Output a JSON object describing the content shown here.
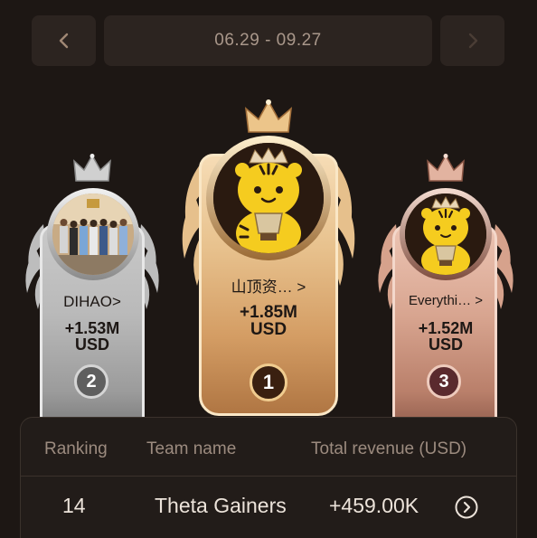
{
  "date_nav": {
    "range": "06.29 - 09.27",
    "prev_icon": "chevron-left-icon",
    "next_icon": "chevron-right-icon"
  },
  "podium": [
    {
      "rank": "2",
      "team": "DIHAO>",
      "revenue_value": "+1.53M",
      "revenue_unit": "USD",
      "tier": "silver"
    },
    {
      "rank": "1",
      "team": "山顶资… >",
      "revenue_value": "+1.85M",
      "revenue_unit": "USD",
      "tier": "gold"
    },
    {
      "rank": "3",
      "team": "Everythi… >",
      "revenue_value": "+1.52M",
      "revenue_unit": "USD",
      "tier": "bronze"
    }
  ],
  "table": {
    "headers": {
      "ranking": "Ranking",
      "team": "Team name",
      "revenue": "Total revenue (USD)"
    },
    "rows": [
      {
        "ranking": "14",
        "team": "Theta Gainers",
        "revenue": "+459.00K",
        "action_icon": "chevron-circle-right-icon"
      }
    ]
  },
  "colors": {
    "background": "#1d1714",
    "gold": "#e8c28e",
    "silver": "#b9b9b9",
    "bronze": "#d8a590"
  }
}
